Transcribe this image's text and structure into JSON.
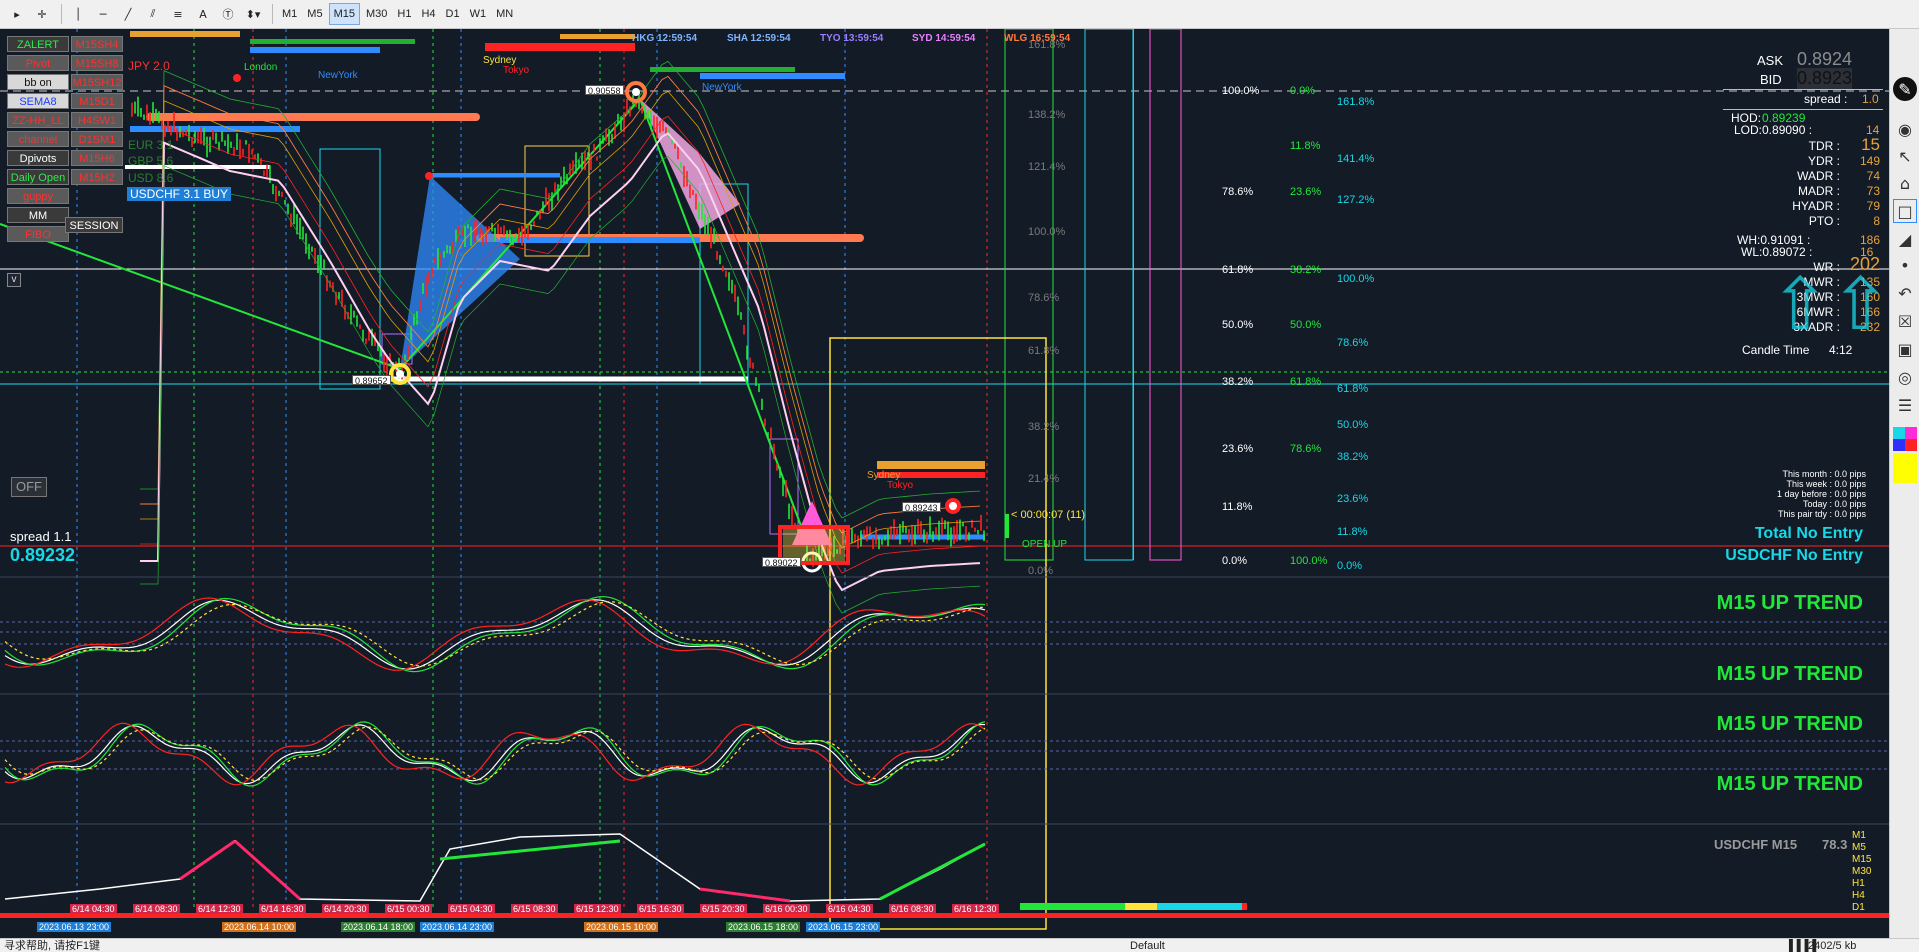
{
  "toolbar": {
    "timeframes": [
      "M1",
      "M5",
      "M15",
      "M30",
      "H1",
      "H4",
      "D1",
      "W1",
      "MN"
    ],
    "active_timeframe": "M15"
  },
  "left_panel": {
    "buttons": [
      "ZALERT",
      "Pivot",
      "bb on",
      "SEMA8",
      "ZZ-HH_LL",
      "channel",
      "Dpivots",
      "Daily Open",
      "guppy",
      "MM",
      "FIBO"
    ],
    "tf_labels": [
      "M15SH4",
      "M15SH8",
      "M15SH12",
      "M15D1",
      "H4SW1",
      "D1SM1",
      "M15H6",
      "M15H2"
    ],
    "session_button": "SESSION",
    "currency_rows": [
      "JPY 2.0",
      "EUR 3.1",
      "GBP 5.6",
      "USD 8.6"
    ],
    "signal": "USDCHF 3.1 BUY",
    "off_button": "OFF",
    "v_button": "v"
  },
  "hud": {
    "spread_label": "spread 1.1",
    "price": "0.89232",
    "ask_label": "ASK",
    "ask_value": "0.8924",
    "bid_label": "BID",
    "bid_value": "0.8923",
    "spread_key": "spread :",
    "spread_value": "1.0",
    "hod": "HOD:",
    "hod_value": "0.89239",
    "lod": "LOD:0.89090 :",
    "lod_value": "14",
    "candle_time_label": "Candle Time",
    "candle_time_value": "4:12",
    "wh": "WH:0.91091 :",
    "wh_value": "186",
    "wl": "WL:0.89072 :",
    "wl_value": "16"
  },
  "stats": [
    {
      "k": "TDR :",
      "v": "15"
    },
    {
      "k": "YDR :",
      "v": "149"
    },
    {
      "k": "WADR :",
      "v": "74"
    },
    {
      "k": "MADR :",
      "v": "73"
    },
    {
      "k": "HYADR :",
      "v": "79"
    },
    {
      "k": "PTO :",
      "v": "8"
    }
  ],
  "stats2": [
    {
      "k": "WR :",
      "v": "202"
    },
    {
      "k": "MWR :",
      "v": "135"
    },
    {
      "k": "3MWR :",
      "v": "160"
    },
    {
      "k": "6MWR :",
      "v": "166"
    },
    {
      "k": "3XADR :",
      "v": "232"
    }
  ],
  "pips": [
    "This month : 0.0 pips",
    "This week : 0.0 pips",
    "1 day before : 0.0 pips",
    "Today : 0.0 pips",
    "This pair tdy : 0.0 pips"
  ],
  "entries": {
    "total": "Total No Entry",
    "pair": "USDCHF No Entry"
  },
  "trends": [
    "M15 UP TREND",
    "M15 UP TREND",
    "M15 UP TREND",
    "M15 UP TREND"
  ],
  "bottom_panel": {
    "label": "USDCHF M15",
    "value": "78.3",
    "tfs": [
      "M1",
      "M5",
      "M15",
      "M30",
      "H1",
      "H4",
      "D1"
    ]
  },
  "sessions_top": [
    {
      "name": "HKG 12:59:54",
      "color": "#7fb3ff"
    },
    {
      "name": "SHA 12:59:54",
      "color": "#7fb3ff"
    },
    {
      "name": "TYO 13:59:54",
      "color": "#9b7dff"
    },
    {
      "name": "SYD 14:59:54",
      "color": "#e87fff"
    },
    {
      "name": "WLG 16:59:54",
      "color": "#ff7a3d"
    }
  ],
  "session_names": [
    "London",
    "NewYork",
    "Sydney",
    "Tokyo",
    "NewYork"
  ],
  "price_tags": [
    "0.90558",
    "0.89652",
    "0.89243",
    "0.89022"
  ],
  "countdown": "< 00:00:07 (11)",
  "open_up": "OPEN UP",
  "fib_left": [
    {
      "p": "100.0%",
      "v": "0.0%"
    },
    {
      "p": "",
      "v": "11.8%"
    },
    {
      "p": "78.6%",
      "v": "23.6%"
    },
    {
      "p": "61.8%",
      "v": "38.2%"
    },
    {
      "p": "50.0%",
      "v": "50.0%"
    },
    {
      "p": "38.2%",
      "v": "61.8%"
    },
    {
      "p": "23.6%",
      "v": "78.6%"
    },
    {
      "p": "11.8%",
      "v": ""
    },
    {
      "p": "0.0%",
      "v": "100.0%"
    }
  ],
  "fib_right": [
    "161.8%",
    "141.4%",
    "127.2%",
    "100.0%",
    "78.6%",
    "61.8%",
    "50.0%",
    "38.2%",
    "23.6%",
    "11.8%",
    "0.0%"
  ],
  "fib_mid": [
    "161.8%",
    "138.2%",
    "121.4%",
    "100.0%",
    "78.6%",
    "61.8%",
    "38.2%",
    "21.4%",
    "0.0%"
  ],
  "timeline": [
    "2023.06.13 23:00",
    "2023.06.14 10:00",
    "2023.06.14 18:00",
    "2023.06.14 23:00",
    "2023.06.15 10:00",
    "2023.06.15 18:00",
    "2023.06.15 23:00"
  ],
  "time_axis": [
    "6/14 04:30",
    "6/14 08:30",
    "6/14 12:30",
    "6/14 16:30",
    "6/14 20:30",
    "6/15 00:30",
    "6/15 04:30",
    "6/15 08:30",
    "6/15 12:30",
    "6/15 16:30",
    "6/15 20:30",
    "6/16 00:30",
    "6/16 04:30",
    "6/16 08:30",
    "6/16 12:30"
  ],
  "status": {
    "left": "寻求帮助, 请按F1键",
    "profile": "Default",
    "right": "2402/5 kb"
  },
  "colors": {
    "bg": "#131b27",
    "green": "#23e63a",
    "cyan": "#18d8e8",
    "red": "#ff2222",
    "orange": "#ff7a3d",
    "blue": "#2f8cff",
    "pink": "#ff8fd8",
    "yellow": "#ffe43a"
  }
}
